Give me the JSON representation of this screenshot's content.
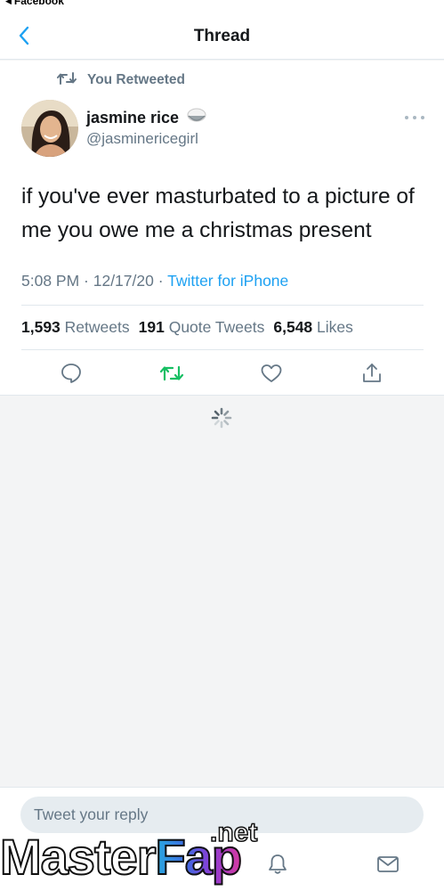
{
  "status_bar": {
    "back_app": "Facebook"
  },
  "nav": {
    "title": "Thread",
    "back_icon": "chevron-left-icon"
  },
  "tweet": {
    "retweet_context": "You Retweeted",
    "display_name": "jasmine rice",
    "handle": "@jasminericegirl",
    "text": "if you've ever masturbated to a picture of me you owe me a christmas present",
    "time": "5:08 PM · 12/17/20 · ",
    "source": "Twitter for iPhone",
    "stats": {
      "retweets_count": "1,593",
      "retweets_label": "Retweets",
      "quote_tweets_count": "191",
      "quote_tweets_label": "Quote Tweets",
      "likes_count": "6,548",
      "likes_label": "Likes"
    },
    "retweeted": true
  },
  "reply": {
    "placeholder": "Tweet your reply"
  },
  "watermark": {
    "main": "Master",
    "accent": "Fap",
    "suffix": ".net"
  },
  "colors": {
    "accent": "#1da1f2",
    "retweet_green": "#17bf63",
    "secondary_text": "#657786",
    "icon_gray": "#657786"
  }
}
